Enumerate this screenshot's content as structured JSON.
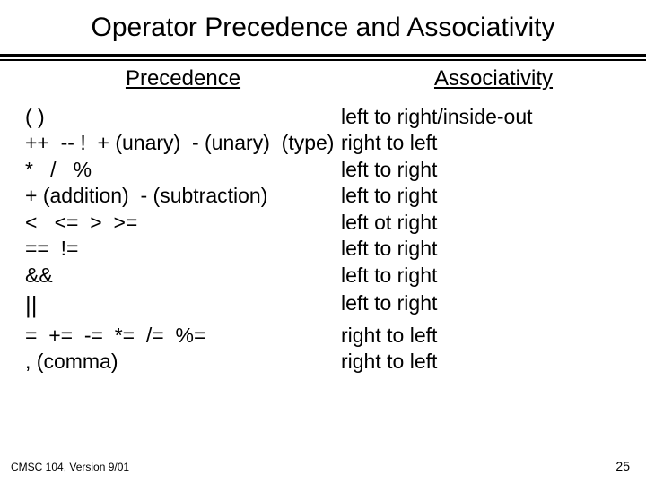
{
  "title": "Operator Precedence and Associativity",
  "headers": {
    "precedence": "Precedence",
    "associativity": "Associativity"
  },
  "rows": [
    {
      "prec": "( )",
      "assoc": "left to right/inside-out"
    },
    {
      "prec": "++  -- !  + (unary)  - (unary)  (type)",
      "assoc": "right to left"
    },
    {
      "prec": "*   /   %",
      "assoc": "left to right"
    },
    {
      "prec": "+ (addition)  - (subtraction)",
      "assoc": "left to right"
    },
    {
      "prec": "<   <=  >  >=",
      "assoc": "left ot right"
    },
    {
      "prec": "==  !=",
      "assoc": "left to right"
    },
    {
      "prec": "&&",
      "assoc": "left to right"
    },
    {
      "prec": "||",
      "assoc": "left to right",
      "tall": true
    },
    {
      "prec": "=  +=  -=  *=  /=  %=",
      "assoc": "right to left"
    },
    {
      "prec": ", (comma)",
      "assoc": "right to left"
    }
  ],
  "footer": {
    "left": "CMSC 104, Version 9/01",
    "right": "25"
  }
}
